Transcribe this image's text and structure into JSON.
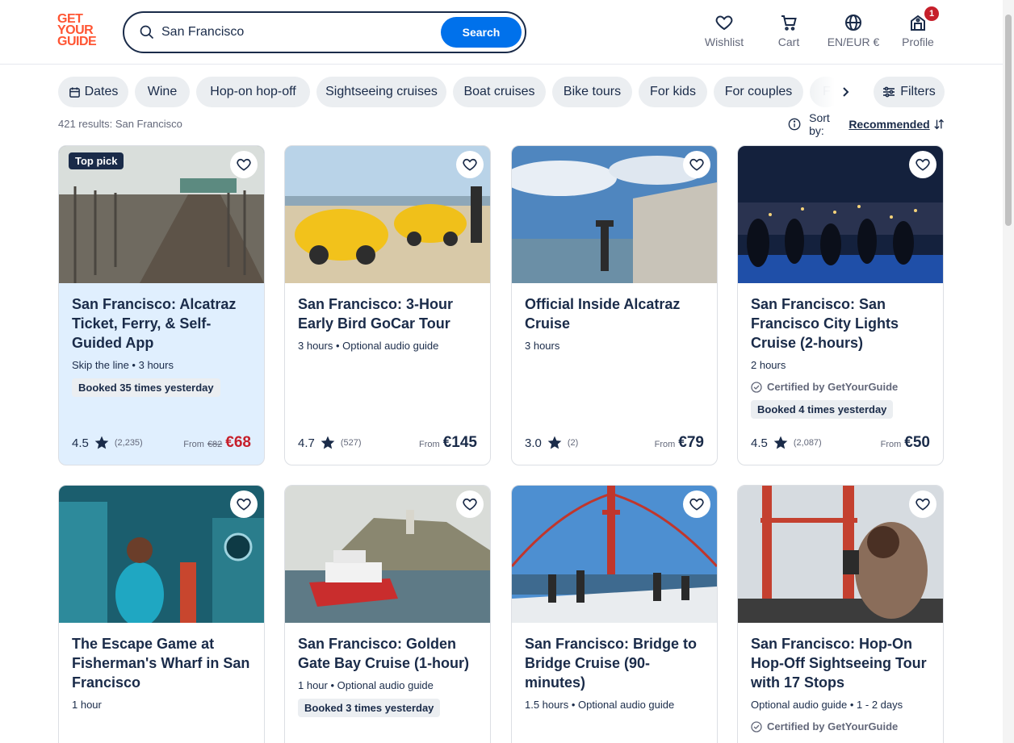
{
  "header": {
    "logo_lines": [
      "GET",
      "YOUR",
      "GUIDE"
    ],
    "search": {
      "value": "San Francisco",
      "button": "Search"
    },
    "nav": [
      {
        "label": "Wishlist",
        "icon": "heart-icon"
      },
      {
        "label": "Cart",
        "icon": "cart-icon"
      },
      {
        "label": "EN/EUR €",
        "icon": "globe-icon"
      },
      {
        "label": "Profile",
        "icon": "profile-icon",
        "badge": "1"
      }
    ]
  },
  "chips": [
    "Dates",
    "Wine",
    "Hop-on hop-off",
    "Sightseeing cruises",
    "Boat cruises",
    "Bike tours",
    "For kids",
    "For couples",
    "F"
  ],
  "filters_label": "Filters",
  "results": {
    "count_text": "421 results: San Francisco",
    "sort_label": "Sort by:",
    "sort_value": "Recommended"
  },
  "cards": [
    {
      "title": "San Francisco: Alcatraz Ticket, Ferry, & Self-Guided App",
      "meta": "Skip the line • 3 hours",
      "booked": "Booked 35 times yesterday",
      "rating": "4.5",
      "reviews": "(2,235)",
      "price_from": "From",
      "price_old": "€82",
      "price": "€68",
      "tag": "Top pick",
      "image": "alcatraz-cellblock"
    },
    {
      "title": "San Francisco: 3-Hour Early Bird GoCar Tour",
      "meta": "3 hours • Optional audio guide",
      "rating": "4.7",
      "reviews": "(527)",
      "price_from": "From",
      "price": "€145",
      "image": "yellow-gocars"
    },
    {
      "title": "Official Inside Alcatraz Cruise",
      "meta": "3 hours",
      "rating": "3.0",
      "reviews": "(2)",
      "price_from": "From",
      "price": "€79",
      "image": "alcatraz-tower"
    },
    {
      "title": "San Francisco: San Francisco City Lights Cruise (2-hours)",
      "meta": "2 hours",
      "certified": "Certified by GetYourGuide",
      "booked": "Booked 4 times yesterday",
      "rating": "4.5",
      "reviews": "(2,087)",
      "price_from": "From",
      "price": "€50",
      "image": "city-lights-night"
    },
    {
      "title": "The Escape Game at Fisherman's Wharf in San Francisco",
      "meta": "1 hour",
      "image": "escape-game"
    },
    {
      "title": "San Francisco: Golden Gate Bay Cruise (1-hour)",
      "meta": "1 hour • Optional audio guide",
      "booked": "Booked 3 times yesterday",
      "image": "red-white-ferry"
    },
    {
      "title": "San Francisco: Bridge to Bridge Cruise (90-minutes)",
      "meta": "1.5 hours • Optional audio guide",
      "image": "golden-gate-deck"
    },
    {
      "title": "San Francisco: Hop-On Hop-Off Sightseeing Tour with 17 Stops",
      "meta": "Optional audio guide • 1 - 2 days",
      "certified": "Certified by GetYourGuide",
      "image": "bus-golden-gate"
    }
  ],
  "colors": {
    "brand": "#ff5533",
    "primary": "#0071eb",
    "navy": "#1a2b49",
    "sale": "#c61f2b",
    "highlight": "#e0effe"
  }
}
